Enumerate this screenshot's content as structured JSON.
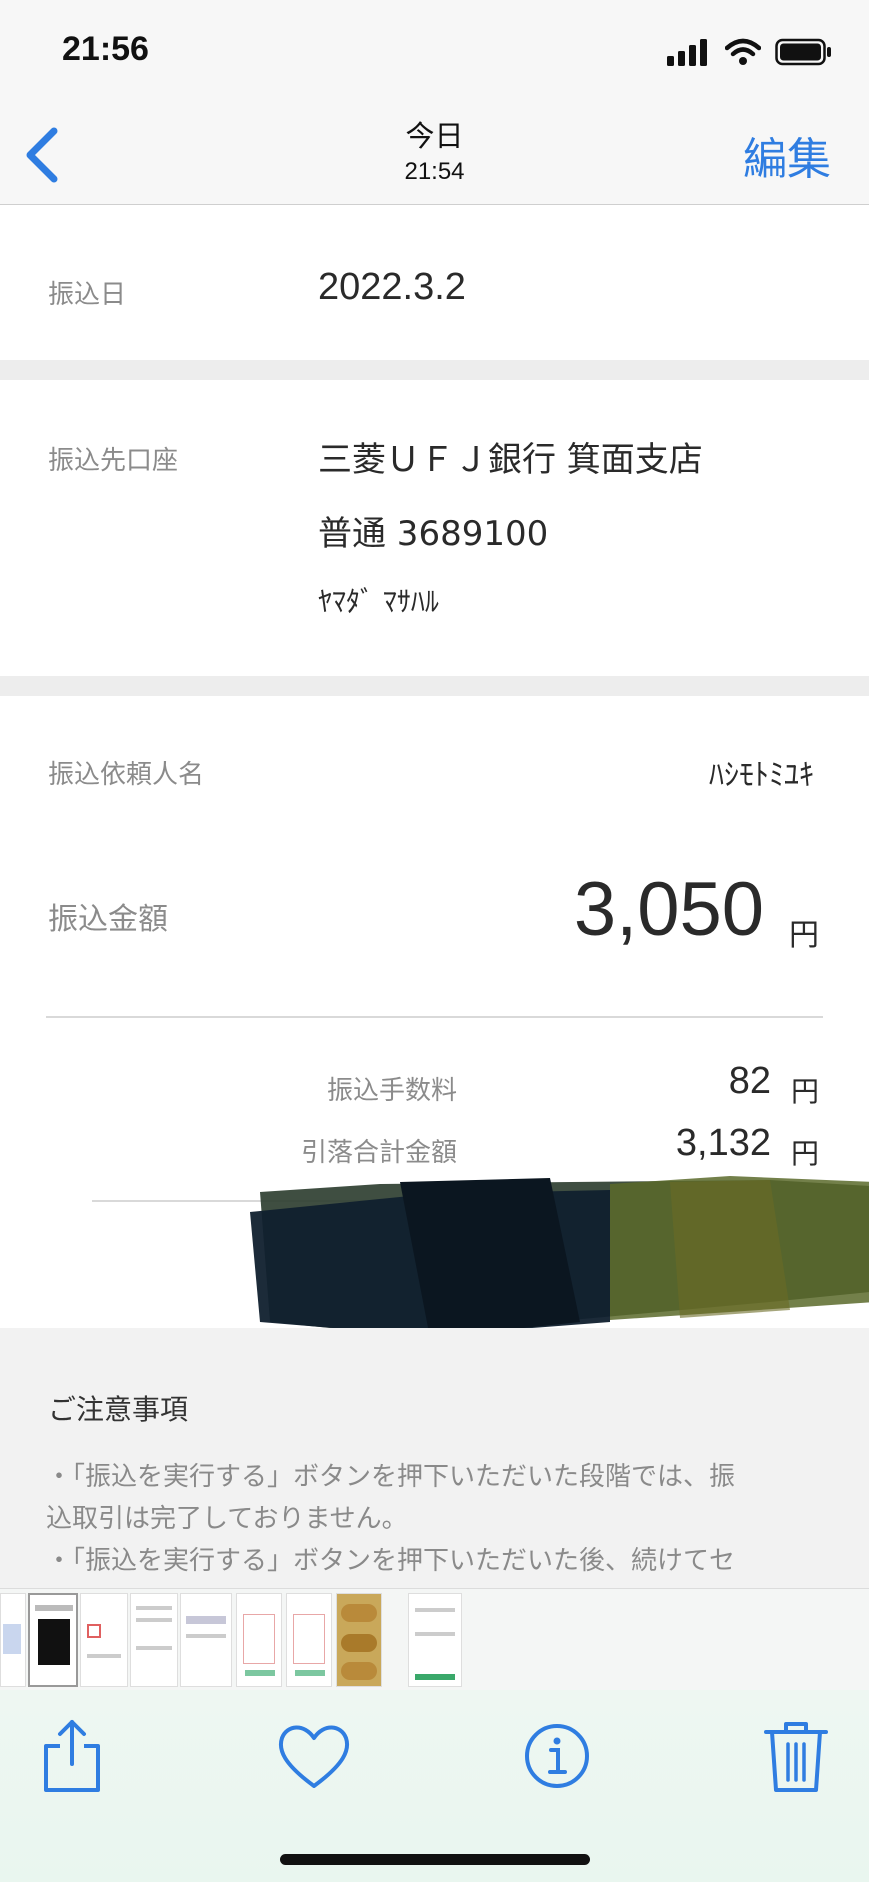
{
  "status_bar": {
    "time": "21:56",
    "icons": [
      "signal-icon",
      "wifi-icon",
      "battery-icon"
    ]
  },
  "nav": {
    "back_icon": "chevron-left-icon",
    "title": "今日",
    "subtitle": "21:54",
    "edit_label": "編集"
  },
  "transfer": {
    "date_label": "振込日",
    "date_value": "2022.3.2",
    "account_label": "振込先口座",
    "bank_line": "三菱ＵＦＪ銀行 箕面支店",
    "account_line": "普通 3689100",
    "holder_name": "ﾔﾏﾀﾞ ﾏｻﾊﾙ",
    "requester_label": "振込依頼人名",
    "requester_name": "ﾊｼﾓﾄﾐﾕｷ",
    "amount_label": "振込金額",
    "amount_value": "3,050",
    "amount_unit": "円",
    "fee_label": "振込手数料",
    "fee_value": "82",
    "fee_unit": "円",
    "total_label": "引落合計金額",
    "total_value": "3,132",
    "total_unit": "円"
  },
  "notice": {
    "title": "ご注意事項",
    "lines": [
      "・「振込を実行する」ボタンを押下いただいた段階では、振",
      "込取引は完了しておりません。",
      "・「振込を実行する」ボタンを押下いただいた後、続けてセ"
    ]
  },
  "toolbar": {
    "share_icon": "share-icon",
    "like_icon": "heart-icon",
    "info_icon": "info-icon",
    "delete_icon": "trash-icon"
  },
  "colors": {
    "accent": "#2f7de1",
    "label_gray": "#8b8b8b",
    "separator": "#ededed"
  }
}
